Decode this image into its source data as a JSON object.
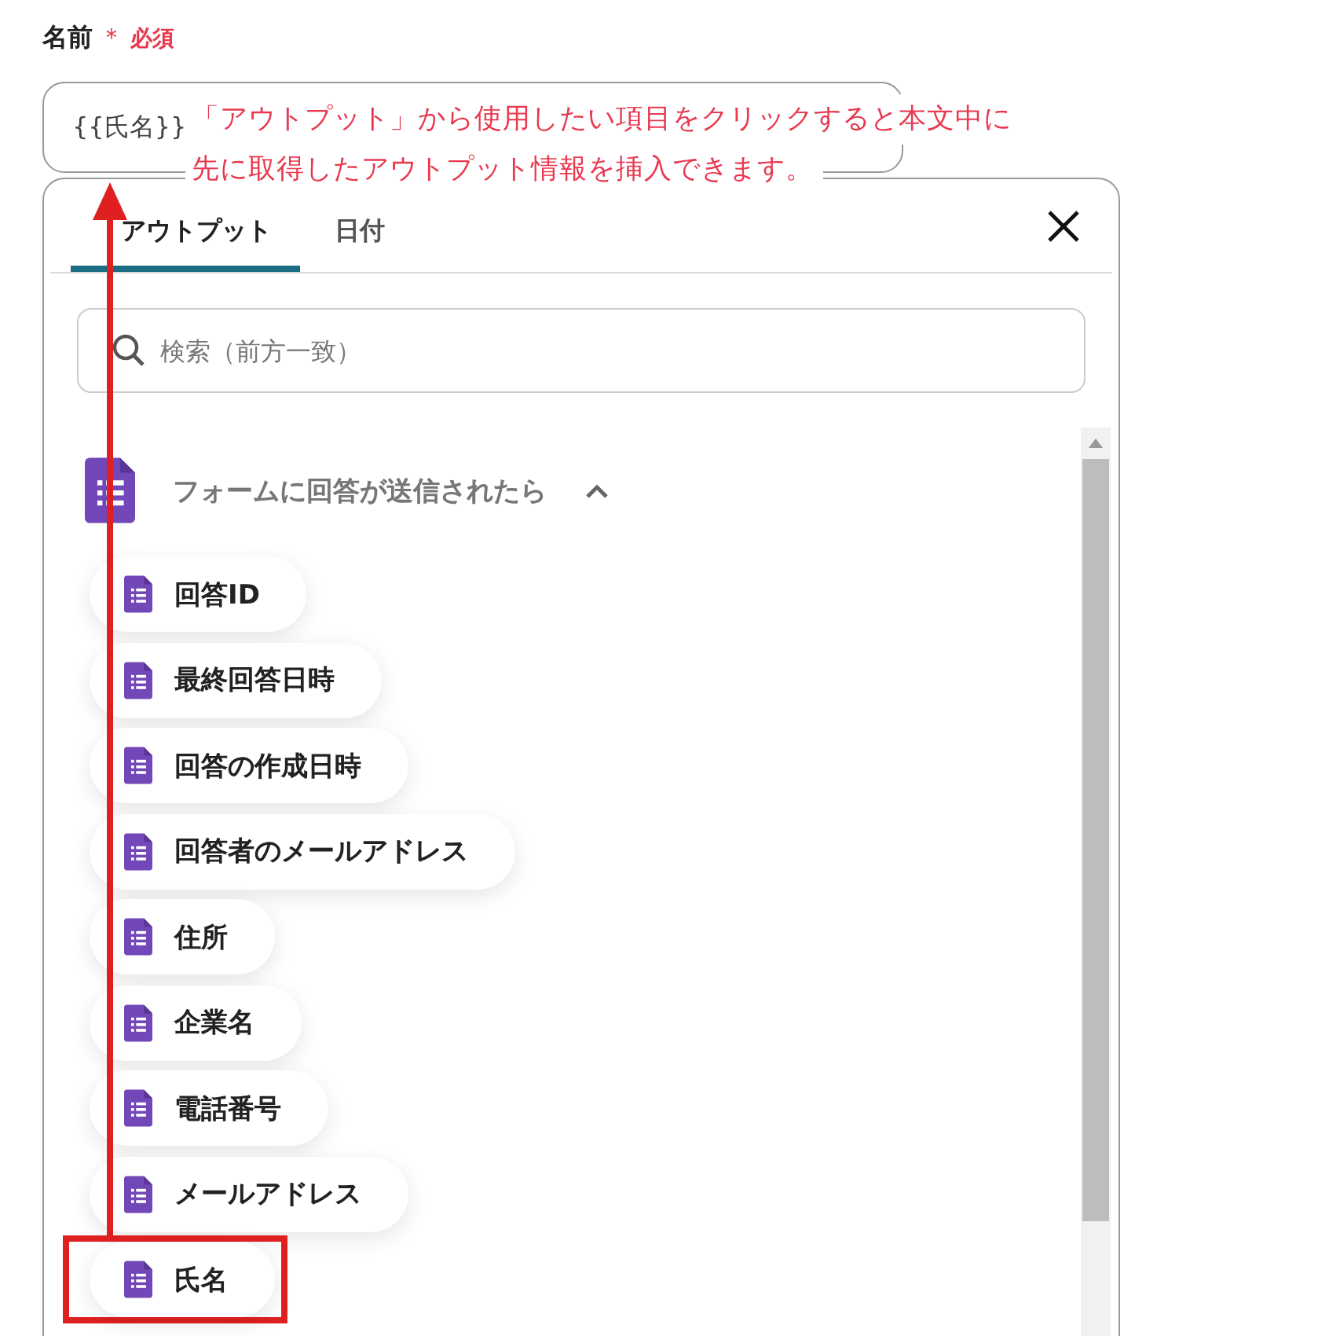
{
  "field": {
    "label": "名前",
    "required_mark": "＊",
    "required_text": "必須",
    "value": "{{氏名}}"
  },
  "annotation": {
    "lines": [
      "「アウトプット」から使用したい項目をクリックすると本文中に",
      "先に取得したアウトプット情報を挿入できます。"
    ]
  },
  "panel": {
    "tabs": [
      {
        "label": "アウトプット",
        "selected": true
      },
      {
        "label": "日付",
        "selected": false
      }
    ],
    "search": {
      "placeholder": "検索（前方一致）"
    },
    "section": {
      "title": "フォームに回答が送信されたら",
      "expanded": true
    },
    "items": [
      {
        "label": "回答ID",
        "highlighted": false
      },
      {
        "label": "最終回答日時",
        "highlighted": false
      },
      {
        "label": "回答の作成日時",
        "highlighted": false
      },
      {
        "label": "回答者のメールアドレス",
        "highlighted": false
      },
      {
        "label": "住所",
        "highlighted": false
      },
      {
        "label": "企業名",
        "highlighted": false
      },
      {
        "label": "電話番号",
        "highlighted": false
      },
      {
        "label": "メールアドレス",
        "highlighted": false
      },
      {
        "label": "氏名",
        "highlighted": true
      }
    ]
  }
}
